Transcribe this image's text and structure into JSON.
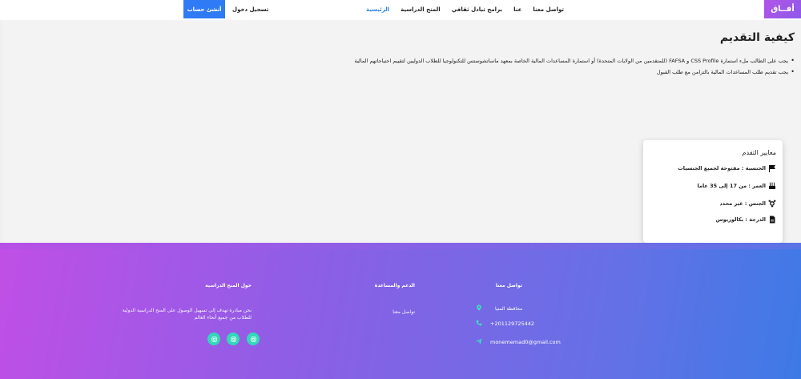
{
  "navbar": {
    "brand": "أفــاق",
    "links": [
      {
        "label": "الرئيسية",
        "active": true
      },
      {
        "label": "المنح الدراسية",
        "active": false
      },
      {
        "label": "برامج تبادل ثقافي",
        "active": false
      },
      {
        "label": "عنا",
        "active": false
      },
      {
        "label": "تواصل معنا",
        "active": false
      }
    ],
    "login_label": "تسجيل دخول",
    "signup_label": "أنشئ حساب"
  },
  "main": {
    "title": "كيفية التقديم",
    "requirements": [
      "يجب على الطالب ملء استمارة CSS Profile و FAFSA (للمتقدمين من الولايات المتحدة) أو استمارة المساعدات المالية الخاصة بمعهد ماساتشوستس للتكنولوجيا للطلاب الدوليين لتقييم احتياجاتهم المالية",
      "يجب تقديم طلب المساعدات المالية بالتزامن مع طلب القبول"
    ]
  },
  "criteria": {
    "title": "معايير التقدم",
    "items": [
      {
        "icon": "flag-icon",
        "text": "الجنسية : مفتوحة لجميع الجنسيات"
      },
      {
        "icon": "cake-icon",
        "text": "العمر : من 17 إلى 35 عاما"
      },
      {
        "icon": "gender-icon",
        "text": "الجنس : غير محدد"
      },
      {
        "icon": "document-icon",
        "text": "الدرجة : بكالوريوس"
      }
    ]
  },
  "footer": {
    "about": {
      "heading": "حول المنح الدراسية",
      "text_line1": "نحن مبادرة تهدف إلى تسهيل الوصول على المنح الدراسية الدولية",
      "text_line2": "للطلاب من جميع أنحاء العالم"
    },
    "support": {
      "heading": "الدعم والمساعدة",
      "link": "تواصل معنا"
    },
    "contact": {
      "heading": "تواصل معنا",
      "location": "محافظة المنيا",
      "phone": "+201129725442",
      "email": "monememad0@gmail.com"
    }
  },
  "colors": {
    "accent": "#2f7bf5",
    "brand": "#b154e9",
    "social": "#32d9b8"
  }
}
